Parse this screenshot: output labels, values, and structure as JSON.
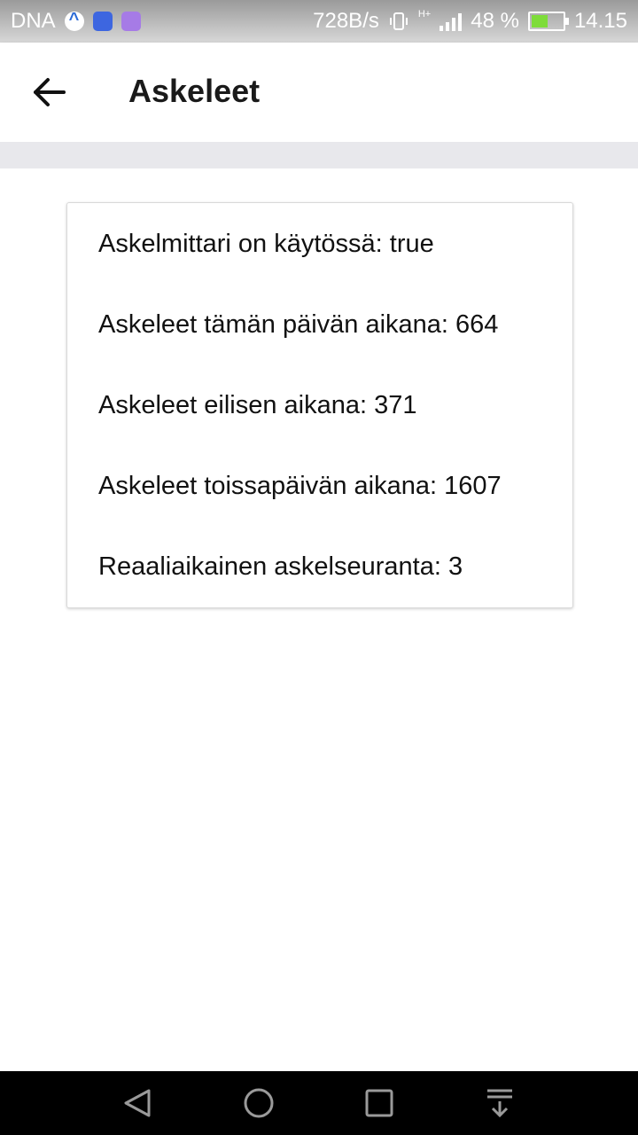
{
  "status_bar": {
    "carrier": "DNA",
    "net_speed": "728B/s",
    "network_type": "H+",
    "battery_percent": "48 %",
    "time": "14.15"
  },
  "app_bar": {
    "title": "Askeleet",
    "back_icon": "arrow-left-icon"
  },
  "card": {
    "rows": [
      "Askelmittari on käytössä: true",
      "Askeleet tämän päivän aikana: 664",
      "Askeleet eilisen aikana: 371",
      "Askeleet toissapäivän aikana: 1607",
      "Reaaliaikainen askelseuranta: 3"
    ]
  },
  "nav_bar": {
    "icons": [
      "back-triangle-icon",
      "home-circle-icon",
      "recents-square-icon",
      "notification-pulldown-icon"
    ]
  }
}
